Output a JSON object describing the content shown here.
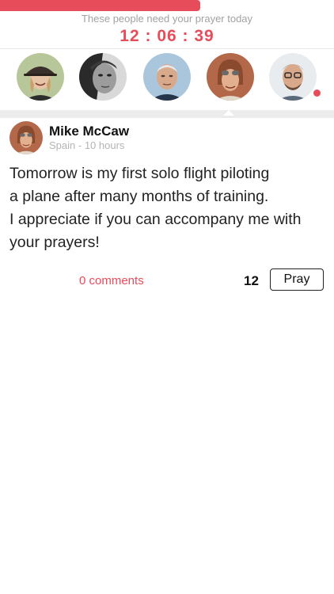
{
  "header": {
    "progress": 0.6,
    "accent_color": "#e74c5a",
    "subtitle": "These people need your prayer today",
    "countdown": "12 : 06 : 39"
  },
  "people_strip": {
    "avatars": [
      {
        "icon": "woman-bowler-hat-avatar"
      },
      {
        "icon": "man-bw-portrait-avatar"
      },
      {
        "icon": "elderly-man-avatar"
      },
      {
        "icon": "man-aviator-cap-avatar",
        "selected": true
      },
      {
        "icon": "man-glasses-beard-avatar",
        "has_notification_dot": true
      }
    ]
  },
  "post": {
    "author": "Mike McCaw",
    "location": "Spain",
    "time": "10 hours",
    "meta_separator": " - ",
    "text_lines": [
      "Tomorrow is my first solo flight piloting",
      "a plane after many months of training.",
      "I appreciate if you can accompany me with",
      "your prayers!"
    ],
    "comments_label": "0 comments",
    "pray_count": "12",
    "pray_label": "Pray"
  }
}
